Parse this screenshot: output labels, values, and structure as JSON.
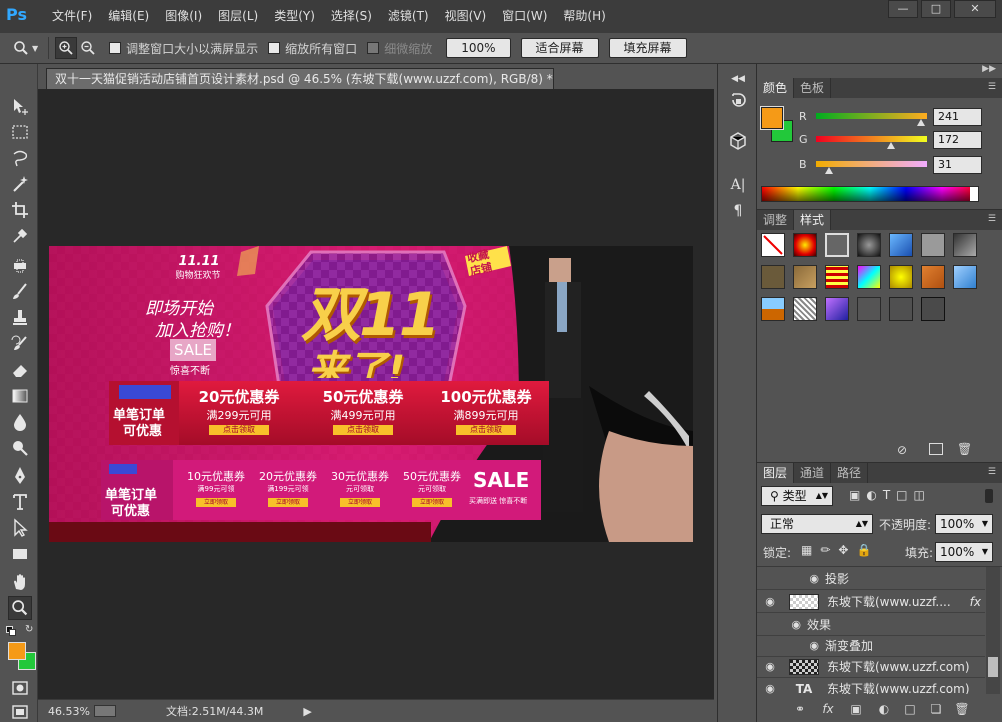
{
  "app": {
    "logo": "Ps"
  },
  "menus": [
    "文件(F)",
    "编辑(E)",
    "图像(I)",
    "图层(L)",
    "类型(Y)",
    "选择(S)",
    "滤镜(T)",
    "视图(V)",
    "窗口(W)",
    "帮助(H)"
  ],
  "options": {
    "resize_windows": "调整窗口大小以满屏显示",
    "zoom_all": "缩放所有窗口",
    "scrubby": "细微缩放",
    "percent_button": "100%",
    "fit_screen": "适合屏幕",
    "fill_screen": "填充屏幕"
  },
  "document": {
    "tab_title": "双十一天猫促销活动店铺首页设计素材.psd @ 46.5% (东坡下载(www.uzzf.com), RGB/8) *",
    "close": "×"
  },
  "banner": {
    "logo": "11.11",
    "logo_sub": "购物狂欢节",
    "line1": "即场开始",
    "line2": "加入抢购！",
    "sale": "SALE",
    "sale_sub": "惊喜不断",
    "headline1": "双11",
    "headline2": "来了!",
    "corner1": "收藏",
    "corner2": "店铺",
    "strip1": {
      "left1": "单笔订单",
      "left2": "可优惠",
      "coupons": [
        {
          "title": "20元优惠券",
          "cond": "满299元可用",
          "btn": "点击领取"
        },
        {
          "title": "50元优惠券",
          "cond": "满499元可用",
          "btn": "点击领取"
        },
        {
          "title": "100元优惠券",
          "cond": "满899元可用",
          "btn": "点击领取"
        }
      ]
    },
    "strip2": {
      "left1": "单笔订单",
      "left2": "可优惠",
      "coupons": [
        {
          "title": "10元优惠券",
          "cond": "满99元可领",
          "btn": "立即领取"
        },
        {
          "title": "20元优惠券",
          "cond": "满199元可领",
          "btn": "立即领取"
        },
        {
          "title": "30元优惠券",
          "cond": "元可领取",
          "btn": "立即领取"
        },
        {
          "title": "50元优惠券",
          "cond": "元可领取",
          "btn": "立即领取"
        }
      ],
      "sale": "SALE",
      "sale_sub": "买满即送 惊喜不断"
    }
  },
  "status": {
    "zoom": "46.53%",
    "doc": "文档:2.51M/44.3M"
  },
  "color_panel": {
    "tabs": [
      "颜色",
      "色板"
    ],
    "foreground": "#f59a17",
    "background": "#22c83a",
    "channels": [
      {
        "label": "R",
        "value": "241",
        "fraction": 0.945
      },
      {
        "label": "G",
        "value": "172",
        "fraction": 0.675
      },
      {
        "label": "B",
        "value": "31",
        "fraction": 0.12
      }
    ]
  },
  "styles_panel": {
    "tabs": [
      "调整",
      "样式"
    ]
  },
  "layers_panel": {
    "tabs": [
      "图层",
      "通道",
      "路径"
    ],
    "filter": "类型",
    "blend": "正常",
    "opacity_label": "不透明度:",
    "opacity": "100%",
    "lock_label": "锁定:",
    "fill_label": "填充:",
    "fill": "100%",
    "rows": [
      {
        "kind": "effect",
        "name": "投影"
      },
      {
        "kind": "layer",
        "name": "东坡下载(www.uzzf....",
        "fx": "fx"
      },
      {
        "kind": "effects-header",
        "name": "效果"
      },
      {
        "kind": "effect",
        "name": "渐变叠加"
      },
      {
        "kind": "layer",
        "name": "东坡下载(www.uzzf.com)"
      },
      {
        "kind": "text",
        "name": "东坡下载(www.uzzf.com)",
        "thumb": "TA"
      }
    ]
  }
}
